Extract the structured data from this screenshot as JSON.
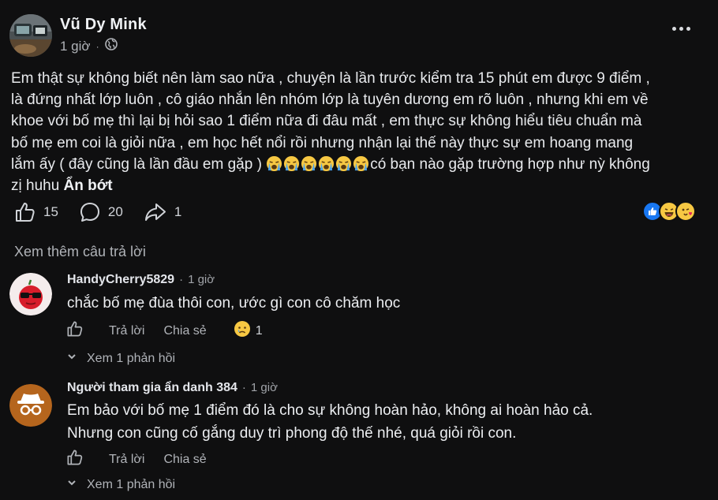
{
  "post": {
    "author": "Vũ Dy Mink",
    "time": "1 giờ",
    "privacy_icon": "globe-icon",
    "menu_icon": "more-icon",
    "body_lines": [
      "Em thật sự không biết nên làm sao nữa , chuyện là lần trước kiểm tra 15 phút em được 9 điểm ,",
      "là đứng nhất lớp luôn , cô giáo nhắn lên nhóm lớp là tuyên dương em rõ luôn , nhưng khi em về",
      "khoe với bố mẹ  thì lại bị hỏi sao 1 điểm nữa đi đâu mất , em thực sự không hiểu tiêu chuẩn mà",
      "bố mẹ em coi là giỏi nữa , em học hết nổi rồi nhưng nhận lại thế này thực sự em hoang mang",
      "lắm ấy ( đây cũng là lần đầu em gặp )",
      "có bạn nào gặp trường hợp như nỳ không",
      "zị huhu "
    ],
    "see_less": "Ẩn bớt",
    "emoji_count": 6,
    "likes": "15",
    "comments": "20",
    "shares": "1",
    "reaction_icons": [
      "like-reaction",
      "haha-reaction",
      "love-reaction"
    ]
  },
  "view_more_replies": "Xem thêm câu trả lời",
  "comments": [
    {
      "author": "HandyCherry5829",
      "separator": "·",
      "time": "1 giờ",
      "lines": [
        "chắc bố mẹ đùa thôi con, ước gì con cô chăm học"
      ],
      "reply_label": "Trả lời",
      "share_label": "Chia sẻ",
      "reaction_count": "1",
      "replies_label": "Xem 1 phản hồi"
    },
    {
      "author": "Người tham gia ẩn danh 384",
      "separator": "·",
      "time": "1 giờ",
      "lines": [
        "Em bảo với bố mẹ 1 điểm đó là cho sự không hoàn hảo, không ai hoàn hảo cả.",
        "Nhưng con cũng cố gắng duy trì phong độ thế nhé, quá giỏi rồi con."
      ],
      "reply_label": "Trả lời",
      "share_label": "Chia sẻ",
      "replies_label": "Xem 1 phản hồi"
    }
  ],
  "colors": {
    "background": "#0f0f10",
    "text": "#e4e6eb",
    "muted": "#b0b3b8",
    "like_blue": "#1877f2",
    "emoji_yellow": "#f7c843"
  }
}
